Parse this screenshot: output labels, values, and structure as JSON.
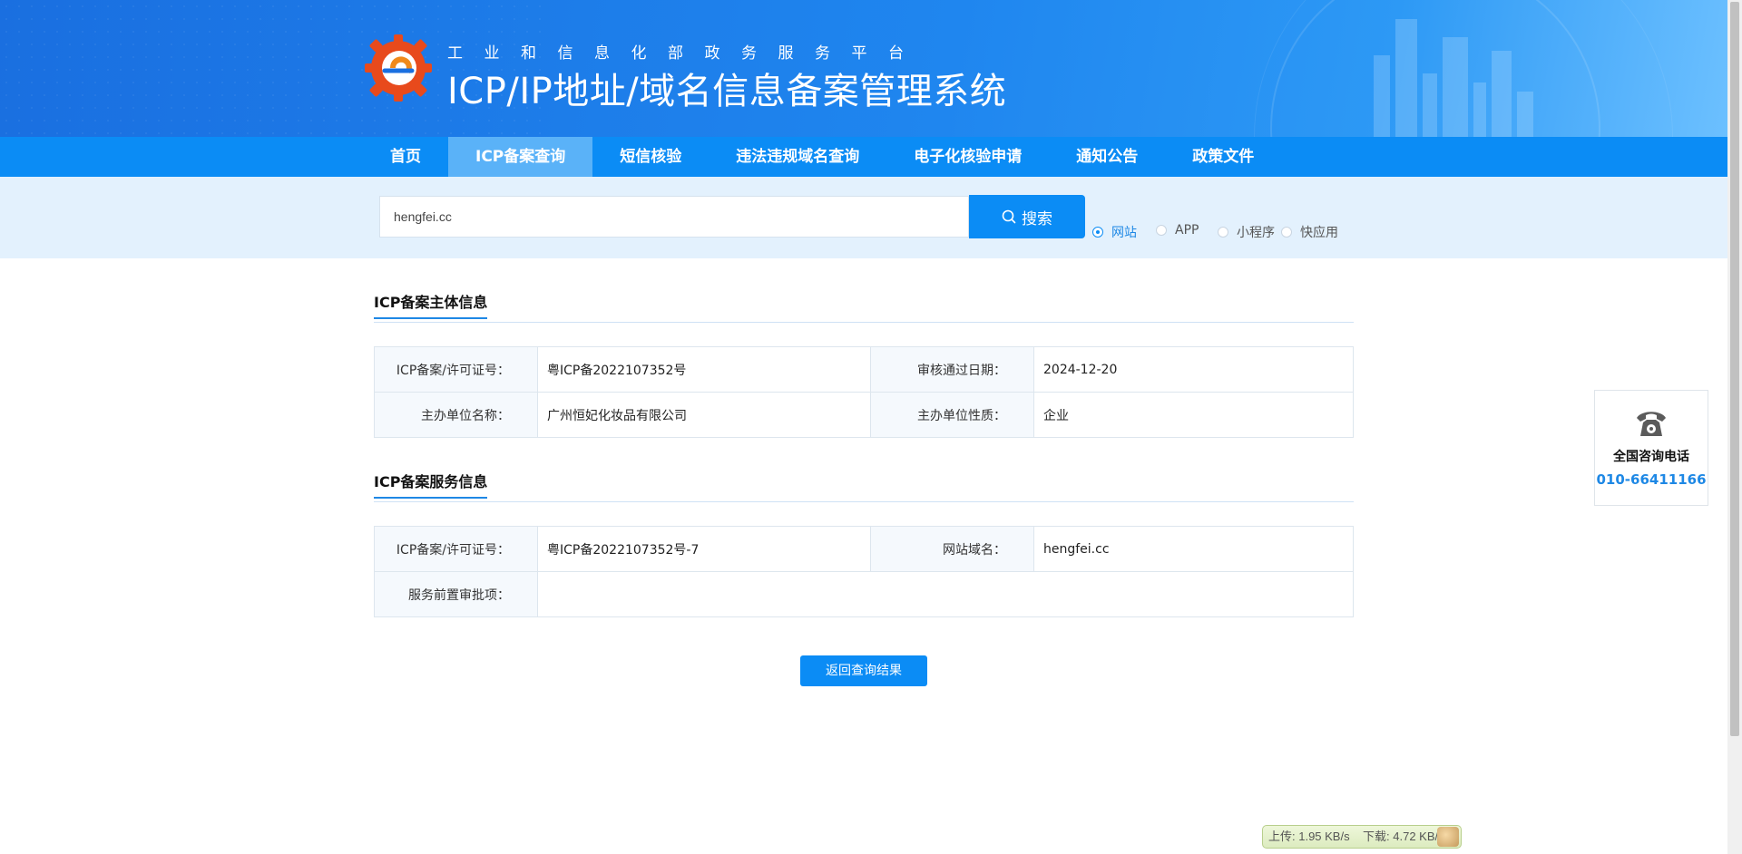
{
  "header": {
    "subtitle": "工业和信息化部政务服务平台",
    "title": "ICP/IP地址/域名信息备案管理系统"
  },
  "nav": {
    "items": [
      "首页",
      "ICP备案查询",
      "短信核验",
      "违法违规域名查询",
      "电子化核验申请",
      "通知公告",
      "政策文件"
    ],
    "active_index": 1
  },
  "search": {
    "value": "hengfei.cc",
    "button_label": "搜索",
    "types": [
      "网站",
      "APP",
      "小程序",
      "快应用"
    ],
    "selected_type": "网站"
  },
  "subject_info": {
    "title": "ICP备案主体信息",
    "rows": [
      {
        "label1": "ICP备案/许可证号：",
        "value1": "粤ICP备2022107352号",
        "label2": "审核通过日期：",
        "value2": "2024-12-20"
      },
      {
        "label1": "主办单位名称：",
        "value1": "广州恒妃化妆品有限公司",
        "label2": "主办单位性质：",
        "value2": "企业"
      }
    ]
  },
  "service_info": {
    "title": "ICP备案服务信息",
    "rows": [
      {
        "label1": "ICP备案/许可证号：",
        "value1": "粤ICP备2022107352号-7",
        "label2": "网站域名：",
        "value2": "hengfei.cc"
      },
      {
        "label1": "服务前置审批项：",
        "value1": ""
      }
    ]
  },
  "back_button": "返回查询结果",
  "hotline": {
    "label": "全国咨询电话",
    "number": "010-66411166"
  },
  "speed_widget": {
    "upload": "上传: 1.95 KB/s",
    "download": "下载: 4.72 KB/s"
  },
  "colors": {
    "primary": "#0b8cf5",
    "nav_active": "#5ab2f8",
    "search_band": "#e3f1fd",
    "accent_text": "#1e88e5"
  }
}
